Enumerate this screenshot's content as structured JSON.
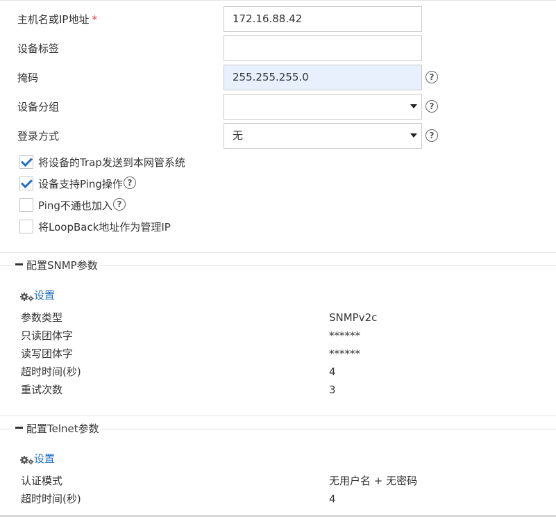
{
  "form": {
    "host": {
      "label": "主机名或IP地址",
      "required_mark": "*",
      "value": "172.16.88.42"
    },
    "device_tag": {
      "label": "设备标签",
      "value": ""
    },
    "mask": {
      "label": "掩码",
      "value": "255.255.255.0"
    },
    "device_group": {
      "label": "设备分组",
      "value": ""
    },
    "login_method": {
      "label": "登录方式",
      "value": "无"
    },
    "help_symbol": "?"
  },
  "checkboxes": [
    {
      "label": "将设备的Trap发送到本网管系统",
      "checked": true
    },
    {
      "label": "设备支持Ping操作",
      "checked": true,
      "has_help": true
    },
    {
      "label": "Ping不通也加入",
      "checked": false,
      "has_help": true
    },
    {
      "label": "将LoopBack地址作为管理IP",
      "checked": false
    }
  ],
  "snmp": {
    "title": "配置SNMP参数",
    "settings_label": "设置",
    "rows": [
      {
        "key": "参数类型",
        "value": "SNMPv2c"
      },
      {
        "key": "只读团体字",
        "value": "******"
      },
      {
        "key": "读写团体字",
        "value": "******"
      },
      {
        "key": "超时时间(秒)",
        "value": "4"
      },
      {
        "key": "重试次数",
        "value": "3"
      }
    ]
  },
  "telnet": {
    "title": "配置Telnet参数",
    "settings_label": "设置",
    "rows": [
      {
        "key": "认证模式",
        "value": "无用户名 + 无密码"
      },
      {
        "key": "超时时间(秒)",
        "value": "4"
      }
    ]
  },
  "colors": {
    "link": "#1f6fc5",
    "required": "#e03b3b",
    "highlight_field": "#e8f0fe",
    "check": "#1f6fc5"
  },
  "icons": {
    "section_toggle": "minus-icon",
    "settings": "gear-icon",
    "help": "help-icon",
    "dropdown": "chevron-down-icon",
    "check": "check-icon"
  }
}
